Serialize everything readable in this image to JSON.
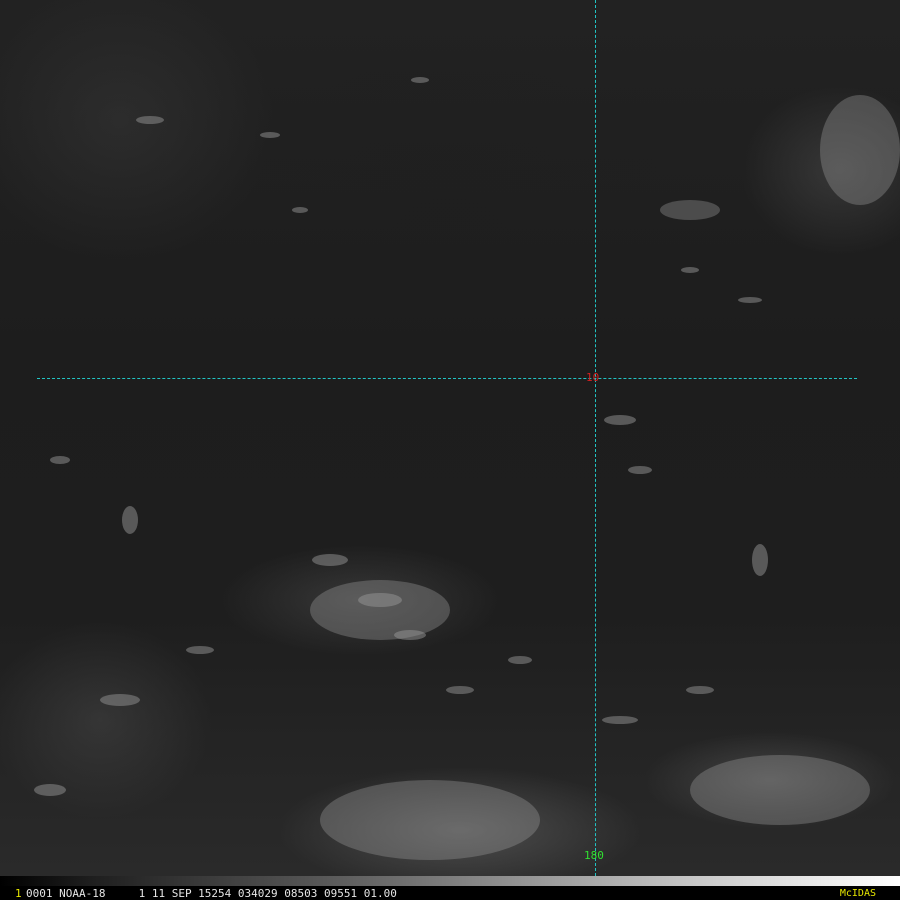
{
  "overlay": {
    "latitude_label": "10",
    "longitude_label": "180",
    "latitude_color": "#d42020",
    "longitude_color": "#30e030",
    "grid_color": "#22c4c4"
  },
  "status_bar": {
    "frame_number": "1",
    "info": "0001 NOAA-18     1 11 SEP 15254 034029 08503 09551 01.00",
    "brand": "McIDAS",
    "frame_number_color": "#e8e800",
    "brand_color": "#e8e800"
  }
}
